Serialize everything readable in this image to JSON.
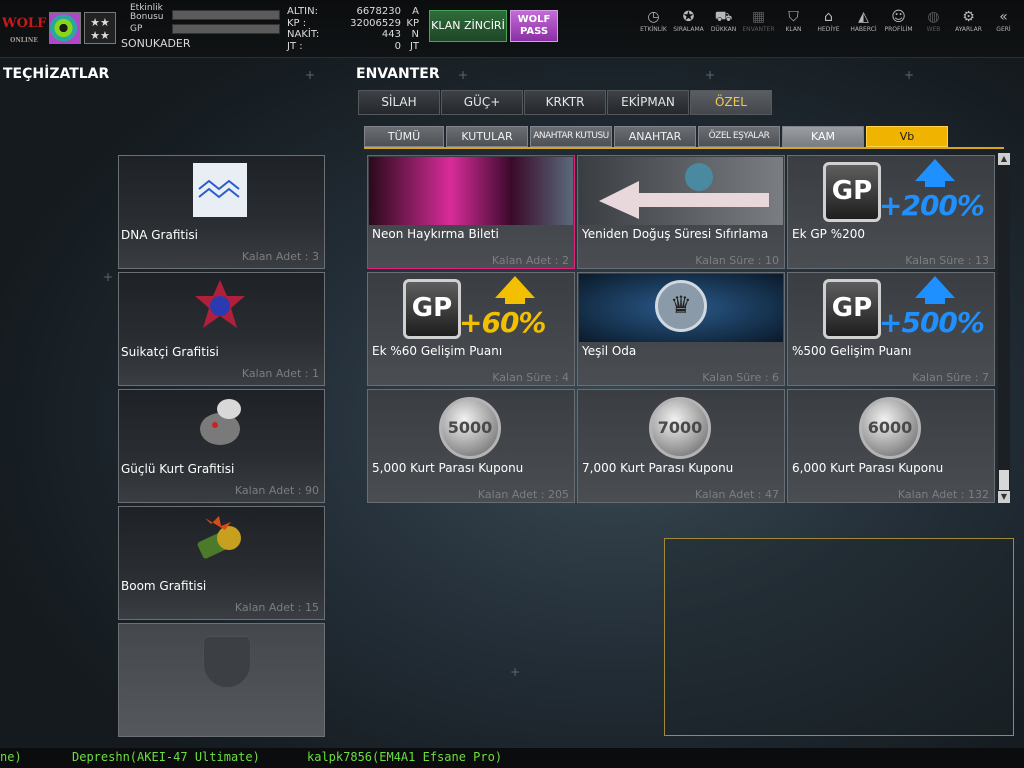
{
  "player": {
    "logo_text": "WOLF",
    "logo_sub": "ONLINE",
    "rank_symbol": "★★\n★★",
    "bonus_label": "Etkinlik Bonusu",
    "gp_label": "GP",
    "username": "SONUKADER",
    "bonus_fill": 0.0,
    "gp_fill": 0.0
  },
  "currency": [
    {
      "label": "ALTIN:",
      "value": "6678230",
      "unit": "A"
    },
    {
      "label": "KP :",
      "value": "32006529",
      "unit": "KP"
    },
    {
      "label": "NAKİT:",
      "value": "443",
      "unit": "N"
    },
    {
      "label": "JT :",
      "value": "0",
      "unit": "JT"
    }
  ],
  "buttons": {
    "klan": "KLAN ZİNCİRİ",
    "wolf_pass": "WOLF PASS"
  },
  "topnav": [
    {
      "label": "ETKİNLİK",
      "icon": "stopwatch-icon",
      "glyph": "◷",
      "disabled": false
    },
    {
      "label": "SIRALAMA",
      "icon": "medal-icon",
      "glyph": "✪",
      "disabled": false
    },
    {
      "label": "DÜKKAN",
      "icon": "cart-icon",
      "glyph": "⛟",
      "disabled": false
    },
    {
      "label": "ENVANTER",
      "icon": "inventory-icon",
      "glyph": "▦",
      "disabled": true
    },
    {
      "label": "KLAN",
      "icon": "shield-icon",
      "glyph": "⛉",
      "disabled": false
    },
    {
      "label": "HEDİYE",
      "icon": "gift-icon",
      "glyph": "⌂",
      "disabled": false
    },
    {
      "label": "HABERCİ",
      "icon": "megaphone-icon",
      "glyph": "◭",
      "disabled": false
    },
    {
      "label": "PROFİLİM",
      "icon": "profile-icon",
      "glyph": "☺",
      "disabled": false
    },
    {
      "label": "WEB",
      "icon": "globe-icon",
      "glyph": "◍",
      "disabled": true
    },
    {
      "label": "AYARLAR",
      "icon": "gear-icon",
      "glyph": "⚙",
      "disabled": false
    },
    {
      "label": "GERİ",
      "icon": "back-icon",
      "glyph": "«",
      "disabled": false
    }
  ],
  "headers": {
    "equipment": "TEÇHİZATLAR",
    "inventory": "ENVANTER"
  },
  "equipment": [
    {
      "name": "DNA Grafitisi",
      "count": "Kalan Adet : 3"
    },
    {
      "name": "Suikatçi Grafitisi",
      "count": "Kalan Adet : 1"
    },
    {
      "name": "Güçlü Kurt Grafitisi",
      "count": "Kalan Adet : 90"
    },
    {
      "name": "Boom Grafitisi",
      "count": "Kalan Adet : 15"
    }
  ],
  "category_tabs": [
    {
      "label": "SİLAH",
      "active": false
    },
    {
      "label": "GÜÇ+",
      "active": false
    },
    {
      "label": "KRKTR",
      "active": false
    },
    {
      "label": "EKİPMAN",
      "active": false
    },
    {
      "label": "ÖZEL",
      "active": true
    }
  ],
  "sub_tabs": [
    {
      "label": "TÜMÜ",
      "style": "normal"
    },
    {
      "label": "KUTULAR",
      "style": "normal"
    },
    {
      "label": "ANAHTAR KUTUSU",
      "style": "small"
    },
    {
      "label": "ANAHTAR",
      "style": "normal"
    },
    {
      "label": "ÖZEL EŞYALAR",
      "style": "small"
    },
    {
      "label": "KAM",
      "style": "active"
    },
    {
      "label": "Vb",
      "style": "gold"
    }
  ],
  "items": [
    {
      "name": "Neon Haykırma Bileti",
      "meta": "Kalan Adet : 2",
      "art": "neon"
    },
    {
      "name": "Yeniden Doğuş Süresi Sıfırlama",
      "meta": "Kalan Süre : 10",
      "art": "respawn"
    },
    {
      "name": "Ek GP %200",
      "meta": "Kalan Süre : 13",
      "art": "gp",
      "pct": "+200%"
    },
    {
      "name": "Ek %60 Gelişim Puanı",
      "meta": "Kalan Süre : 4",
      "art": "gp",
      "pct": "+60%"
    },
    {
      "name": "Yeşil Oda",
      "meta": "Kalan Süre : 6",
      "art": "room"
    },
    {
      "name": "%500 Gelişim Puanı",
      "meta": "Kalan Süre : 7",
      "art": "gp",
      "pct": "+500%"
    },
    {
      "name": "5,000 Kurt Parası Kuponu",
      "meta": "Kalan Adet : 205",
      "art": "coin",
      "coin": "5000"
    },
    {
      "name": "7,000 Kurt Parası Kuponu",
      "meta": "Kalan Adet : 47",
      "art": "coin",
      "coin": "7000"
    },
    {
      "name": "6,000 Kurt Parası Kuponu",
      "meta": "Kalan Adet : 132",
      "art": "coin",
      "coin": "6000"
    }
  ],
  "colors": {
    "gold_accent": "#f0b400",
    "plus_blue": "#1e90ff",
    "plus_gold": "#f2c000",
    "chat_green": "#6edd40"
  },
  "chat": [
    "ne)",
    "Depreshn(AKEI-47 Ultimate)",
    "kalpk7856(EM4A1 Efsane Pro)"
  ]
}
